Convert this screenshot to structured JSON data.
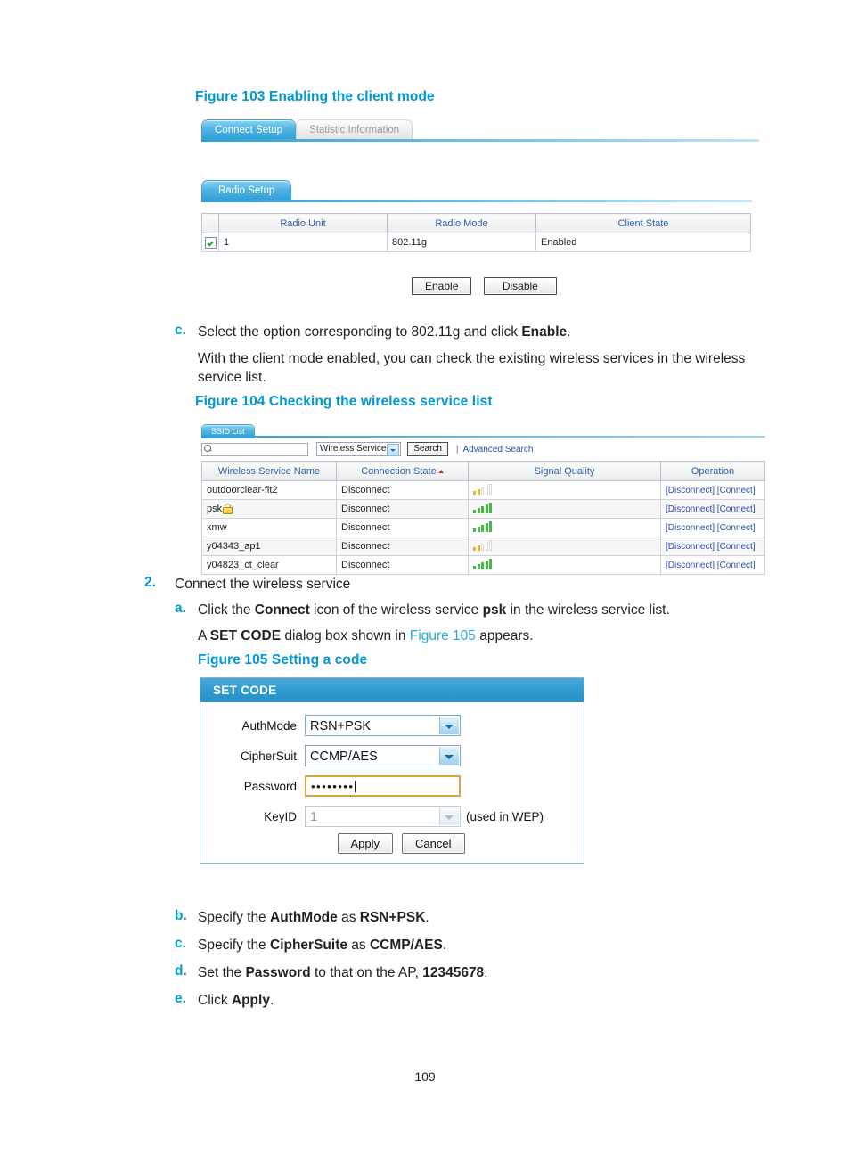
{
  "page": {
    "number": "109"
  },
  "figure103": {
    "caption": "Figure 103 Enabling the client mode",
    "tabs": [
      {
        "label": "Connect Setup",
        "active": true
      },
      {
        "label": "Statistic Information",
        "active": false
      }
    ],
    "panel_tab": "Radio Setup",
    "table": {
      "headers": [
        "",
        "Radio Unit",
        "Radio Mode",
        "Client State"
      ],
      "rows": [
        {
          "checked": true,
          "radio_unit": "1",
          "radio_mode": "802.11g",
          "client_state": "Enabled"
        }
      ]
    },
    "buttons": {
      "enable": "Enable",
      "disable": "Disable"
    }
  },
  "step_c": {
    "letter": "c.",
    "line1_pre": "Select the option corresponding to 802.11g and click ",
    "line1_bold": "Enable",
    "line1_post": ".",
    "line2": "With the client mode enabled, you can check the existing wireless services in the wireless service list."
  },
  "figure104": {
    "caption": "Figure 104 Checking the wireless service list",
    "panel_tab": "SSID List",
    "search": {
      "input_value": "",
      "placeholder": "",
      "select_value": "Wireless Service",
      "search_button": "Search",
      "separator": "|",
      "advanced_link": "Advanced Search"
    },
    "table": {
      "headers": [
        "Wireless Service Name",
        "Connection State",
        "Signal Quality",
        "Operation"
      ],
      "sort_column": "Connection State",
      "rows": [
        {
          "name": "outdoorclear-fit2",
          "lock": false,
          "state": "Disconnect",
          "signal_level": 2,
          "signal_color": "#e8b52a",
          "disconnect": "[Disconnect]",
          "connect": "[Connect]"
        },
        {
          "name": "psk",
          "lock": true,
          "state": "Disconnect",
          "signal_level": 5,
          "signal_color": "#46b946",
          "disconnect": "[Disconnect]",
          "connect": "[Connect]"
        },
        {
          "name": "xmw",
          "lock": false,
          "state": "Disconnect",
          "signal_level": 5,
          "signal_color": "#46b946",
          "disconnect": "[Disconnect]",
          "connect": "[Connect]"
        },
        {
          "name": "y04343_ap1",
          "lock": false,
          "state": "Disconnect",
          "signal_level": 2,
          "signal_color": "#e8b52a",
          "disconnect": "[Disconnect]",
          "connect": "[Connect]"
        },
        {
          "name": "y04823_ct_clear",
          "lock": false,
          "state": "Disconnect",
          "signal_level": 5,
          "signal_color": "#46b946",
          "disconnect": "[Disconnect]",
          "connect": "[Connect]"
        }
      ]
    }
  },
  "step_2": {
    "number": "2.",
    "title": "Connect the wireless service",
    "a": {
      "letter": "a.",
      "pre": "Click the ",
      "b1": "Connect",
      "mid": " icon of the wireless service ",
      "b2": "psk",
      "post": " in the wireless service list.",
      "line2_pre": "A ",
      "line2_b": "SET CODE",
      "line2_mid": " dialog box shown in ",
      "line2_xref": "Figure 105",
      "line2_post": " appears."
    }
  },
  "figure105": {
    "caption": "Figure 105 Setting a code",
    "dialog": {
      "title": "SET CODE",
      "fields": [
        {
          "label": "AuthMode",
          "type": "select",
          "value": "RSN+PSK",
          "disabled": false
        },
        {
          "label": "CipherSuit",
          "type": "select",
          "value": "CCMP/AES",
          "disabled": false
        },
        {
          "label": "Password",
          "type": "password",
          "value": "••••••••",
          "disabled": false
        },
        {
          "label": "KeyID",
          "type": "select",
          "value": "1",
          "disabled": true,
          "hint": "(used in WEP)"
        }
      ],
      "buttons": {
        "apply": "Apply",
        "cancel": "Cancel"
      }
    }
  },
  "steps_tail": [
    {
      "letter": "b.",
      "pre": "Specify the ",
      "b1": "AuthMode",
      "mid": " as ",
      "b2": "RSN+PSK",
      "post": "."
    },
    {
      "letter": "c.",
      "pre": "Specify the ",
      "b1": "CipherSuite",
      "mid": " as ",
      "b2": "CCMP/AES",
      "post": "."
    },
    {
      "letter": "d.",
      "pre": "Set the ",
      "b1": "Password",
      "mid": " to that on the AP, ",
      "b2": "12345678",
      "post": "."
    },
    {
      "letter": "e.",
      "pre": "Click ",
      "b1": "Apply",
      "mid": "",
      "b2": "",
      "post": "."
    }
  ]
}
